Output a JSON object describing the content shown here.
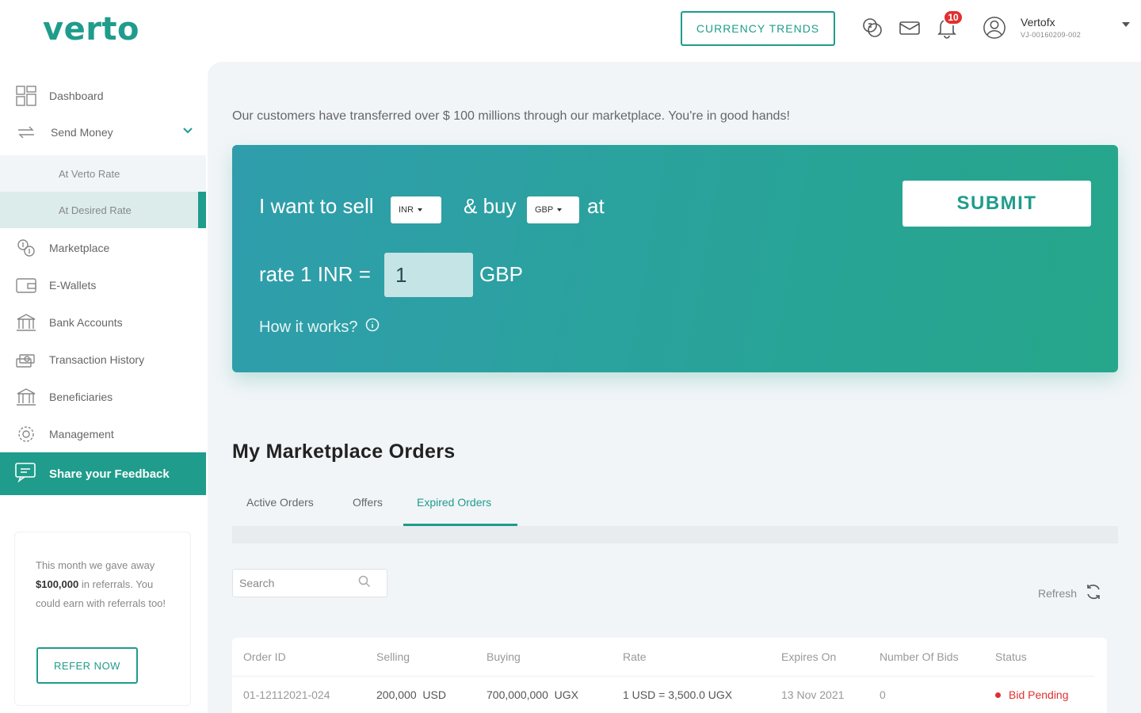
{
  "header": {
    "logo": "verto",
    "currency_trends": "CURRENCY TRENDS",
    "notification_count": "10",
    "user_name": "Vertofx",
    "user_id": "VJ-00160209-002"
  },
  "sidebar": {
    "items": [
      {
        "label": "Dashboard",
        "icon": "dashboard-icon"
      },
      {
        "label": "Send Money",
        "icon": "send-money-icon"
      },
      {
        "label": "At Verto Rate"
      },
      {
        "label": "At Desired Rate"
      },
      {
        "label": "Marketplace",
        "icon": "marketplace-icon"
      },
      {
        "label": "E-Wallets",
        "icon": "wallet-icon"
      },
      {
        "label": "Bank Accounts",
        "icon": "bank-icon"
      },
      {
        "label": "Transaction History",
        "icon": "history-icon"
      },
      {
        "label": "Beneficiaries",
        "icon": "beneficiaries-icon"
      },
      {
        "label": "Management",
        "icon": "gear-icon"
      }
    ],
    "feedback": "Share your Feedback",
    "refer": {
      "text_1": "This month we gave away ",
      "amount": "$100,000",
      "text_2": " in referrals. You could earn with referrals too!",
      "button": "REFER NOW"
    }
  },
  "main": {
    "tagline": "Our customers have transferred over $ 100 millions through our marketplace. You're in good hands!",
    "order_card": {
      "sell_text": "I want to sell",
      "sell_currency": "INR",
      "buy_text": "& buy",
      "buy_currency": "GBP",
      "at_text": "at",
      "rate_prefix": "rate 1 INR =",
      "rate_value": "1",
      "rate_suffix": "GBP",
      "submit": "SUBMIT",
      "how_it_works": "How it works?"
    },
    "orders": {
      "title": "My Marketplace Orders",
      "tabs": [
        "Active Orders",
        "Offers",
        "Expired Orders"
      ],
      "active_tab": "Expired Orders",
      "search_placeholder": "Search",
      "refresh": "Refresh",
      "columns": [
        "Order ID",
        "Selling",
        "Buying",
        "Rate",
        "Expires On",
        "Number Of Bids",
        "Status"
      ],
      "rows": [
        {
          "order_id": "01-12112021-024",
          "selling": "200,000",
          "selling_currency": "USD",
          "buying": "700,000,000",
          "buying_currency": "UGX",
          "rate": "1 USD = 3,500.0 UGX",
          "expires_on": "13 Nov 2021",
          "bids": "0",
          "status": "Bid Pending"
        }
      ]
    }
  },
  "colors": {
    "brand": "#1f9c8c",
    "status_pending": "#e03030"
  }
}
